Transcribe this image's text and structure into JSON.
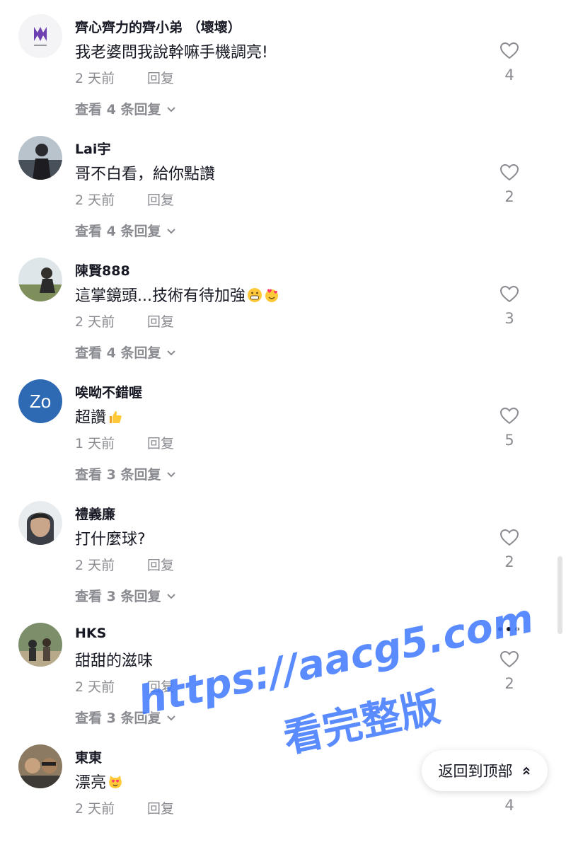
{
  "comments": [
    {
      "username": "齊心齊力的齊小弟 （壞壞）",
      "text": "我老婆問我說幹嘛手機調亮!",
      "time": "2 天前",
      "reply": "回复",
      "likes": "4",
      "view_replies": "查看 4 条回复",
      "avatar": "logo-avatar"
    },
    {
      "username": "Lai宇",
      "text": "哥不白看，給你點讚",
      "time": "2 天前",
      "reply": "回复",
      "likes": "2",
      "view_replies": "查看 4 条回复",
      "avatar": "photo-avatar"
    },
    {
      "username": "陳賢888",
      "text": "這掌鏡頭...技術有待加強",
      "time": "2 天前",
      "reply": "回复",
      "likes": "3",
      "view_replies": "查看 4 条回复",
      "avatar": "photo-avatar"
    },
    {
      "username": "唉呦不錯喔",
      "text": "超讚",
      "time": "1 天前",
      "reply": "回复",
      "likes": "5",
      "view_replies": "查看 3 条回复",
      "avatar_initials": "Zo",
      "avatar_color": "#2e69b3"
    },
    {
      "username": "禮義廉",
      "text": "打什麼球?",
      "time": "2 天前",
      "reply": "回复",
      "likes": "2",
      "view_replies": "查看 3 条回复",
      "avatar": "photo-avatar"
    },
    {
      "username": "HKS",
      "text": "甜甜的滋味",
      "time": "2 天前",
      "reply": "回复",
      "likes": "2",
      "view_replies": "查看 3 条回复",
      "avatar": "photo-avatar"
    },
    {
      "username": "東東",
      "text": "漂亮",
      "time": "2 天前",
      "reply": "回复",
      "likes": "4",
      "avatar": "photo-avatar"
    }
  ],
  "back_to_top": "返回到顶部",
  "watermark": {
    "url": "https://aacg5.com",
    "label": "看完整版"
  },
  "colors": {
    "text": "#161823",
    "muted": "#8a8b91",
    "accent": "#3f78ff"
  }
}
